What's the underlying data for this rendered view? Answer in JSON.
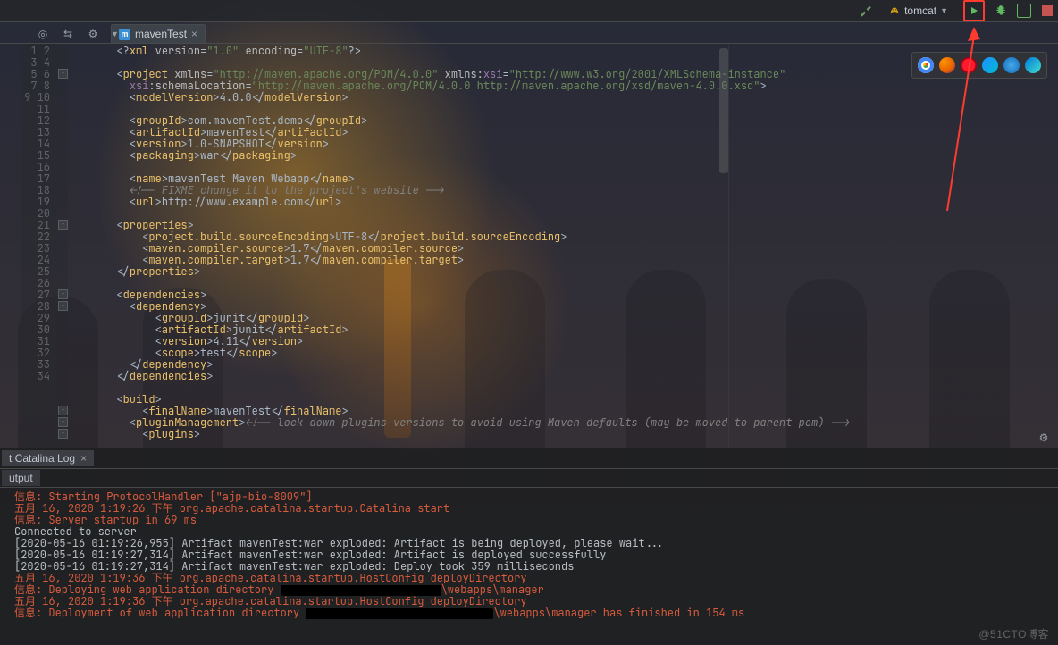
{
  "toolbar": {
    "config_label": "tomcat"
  },
  "tab": {
    "filename": "mavenTest",
    "file_icon_letter": "m"
  },
  "browser_icons": [
    "chrome",
    "firefox",
    "opera",
    "safari",
    "ie",
    "edge"
  ],
  "gutter": {
    "start": 1,
    "end": 34
  },
  "fold_markers": [
    3,
    16,
    22,
    23,
    32,
    33,
    34
  ],
  "code": [
    {
      "kind": "decl",
      "t": "<?xml version=\"1.0\" encoding=\"UTF-8\"?>"
    },
    {
      "kind": "blank"
    },
    {
      "kind": "proj",
      "t": "<project xmlns=\"http://maven.apache.org/POM/4.0.0\" xmlns:xsi=\"http://www.w3.org/2001/XMLSchema-instance\""
    },
    {
      "kind": "proj2",
      "t": "  xsi:schemaLocation=\"http://maven.apache.org/POM/4.0.0 http://maven.apache.org/xsd/maven-4.0.0.xsd\">"
    },
    {
      "kind": "line",
      "open": "modelVersion",
      "text": "4.0.0",
      "close": "modelVersion"
    },
    {
      "kind": "blank"
    },
    {
      "kind": "line",
      "open": "groupId",
      "text": "com.mavenTest.demo",
      "close": "groupId"
    },
    {
      "kind": "line",
      "open": "artifactId",
      "text": "mavenTest",
      "close": "artifactId"
    },
    {
      "kind": "line",
      "open": "version",
      "text": "1.0-SNAPSHOT",
      "close": "version"
    },
    {
      "kind": "line",
      "open": "packaging",
      "text": "war",
      "close": "packaging"
    },
    {
      "kind": "blank"
    },
    {
      "kind": "line",
      "open": "name",
      "text": "mavenTest Maven Webapp",
      "close": "name"
    },
    {
      "kind": "comment",
      "t": "<!-- FIXME change it to the project's website -->"
    },
    {
      "kind": "line",
      "open": "url",
      "text": "http://www.example.com",
      "close": "url"
    },
    {
      "kind": "blank"
    },
    {
      "kind": "open",
      "t": "properties"
    },
    {
      "kind": "line",
      "indent": 2,
      "open": "project.build.sourceEncoding",
      "text": "UTF-8",
      "close": "project.build.sourceEncoding"
    },
    {
      "kind": "line",
      "indent": 2,
      "open": "maven.compiler.source",
      "text": "1.7",
      "close": "maven.compiler.source"
    },
    {
      "kind": "line",
      "indent": 2,
      "open": "maven.compiler.target",
      "text": "1.7",
      "close": "maven.compiler.target"
    },
    {
      "kind": "close",
      "t": "properties"
    },
    {
      "kind": "blank"
    },
    {
      "kind": "open",
      "t": "dependencies"
    },
    {
      "kind": "open",
      "indent": 2,
      "t": "dependency"
    },
    {
      "kind": "line",
      "indent": 4,
      "open": "groupId",
      "text": "junit",
      "close": "groupId"
    },
    {
      "kind": "line",
      "indent": 4,
      "open": "artifactId",
      "text": "junit",
      "close": "artifactId"
    },
    {
      "kind": "line",
      "indent": 4,
      "open": "version",
      "text": "4.11",
      "close": "version"
    },
    {
      "kind": "line",
      "indent": 4,
      "open": "scope",
      "text": "test",
      "close": "scope"
    },
    {
      "kind": "close",
      "indent": 2,
      "t": "dependency"
    },
    {
      "kind": "close",
      "t": "dependencies"
    },
    {
      "kind": "blank"
    },
    {
      "kind": "open",
      "t": "build"
    },
    {
      "kind": "line",
      "indent": 2,
      "open": "finalName",
      "text": "mavenTest",
      "close": "finalName"
    },
    {
      "kind": "open-comment",
      "indent": 2,
      "t": "pluginManagement",
      "c": "<!-- lock down plugins versions to avoid using Maven defaults (may be moved to parent pom) -->"
    },
    {
      "kind": "open",
      "indent": 4,
      "t": "plugins"
    }
  ],
  "bottom": {
    "tab_label": "t Catalina Log",
    "subtab_label": "utput",
    "lines": [
      {
        "cls": "w",
        "t": ""
      },
      {
        "cls": "r",
        "t": "信息: Starting ProtocolHandler [\"ajp-bio-8009\"]"
      },
      {
        "cls": "r",
        "t": "五月 16, 2020 1:19:26 下午 org.apache.catalina.startup.Catalina start"
      },
      {
        "cls": "r",
        "t": "信息: Server startup in 69 ms"
      },
      {
        "cls": "w",
        "t": "Connected to server"
      },
      {
        "cls": "w",
        "t": "[2020-05-16 01:19:26,955] Artifact mavenTest:war exploded: Artifact is being deployed, please wait..."
      },
      {
        "cls": "w",
        "t": "[2020-05-16 01:19:27,314] Artifact mavenTest:war exploded: Artifact is deployed successfully"
      },
      {
        "cls": "w",
        "t": "[2020-05-16 01:19:27,314] Artifact mavenTest:war exploded: Deploy took 359 milliseconds"
      },
      {
        "cls": "r",
        "t": "五月 16, 2020 1:19:36 下午 org.apache.catalina.startup.HostConfig deployDirectory"
      },
      {
        "cls": "r",
        "redact": "a",
        "pre": "信息: Deploying web application directory ",
        "post": "\\webapps\\manager"
      },
      {
        "cls": "r",
        "t": "五月 16, 2020 1:19:36 下午 org.apache.catalina.startup.HostConfig deployDirectory"
      },
      {
        "cls": "r",
        "redact": "b",
        "pre": "信息: Deployment of web application directory ",
        "post": "\\webapps\\manager has finished in 154 ms"
      }
    ]
  },
  "watermark": "@51CTO博客"
}
